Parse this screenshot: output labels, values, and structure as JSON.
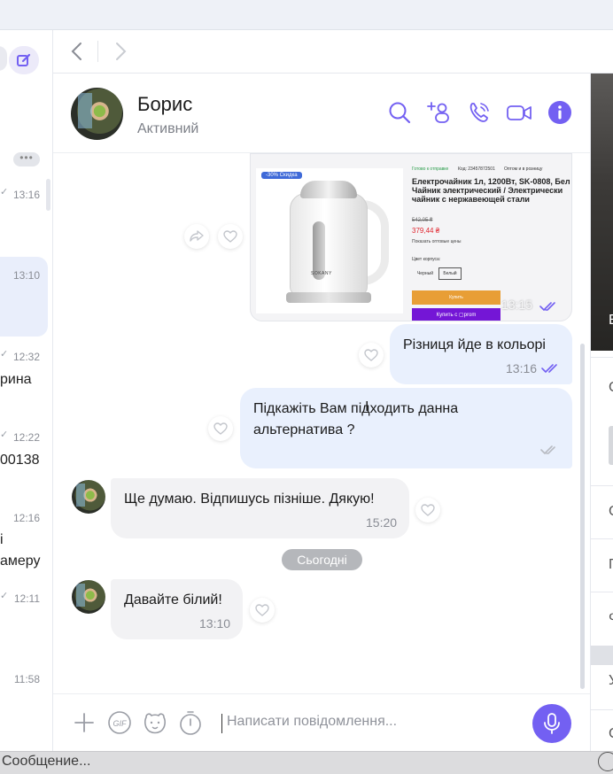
{
  "left_list": {
    "items": [
      {
        "time": "13:16",
        "text": ""
      },
      {
        "time": "13:10",
        "text": ""
      },
      {
        "time": "12:32",
        "text": "рина"
      },
      {
        "time": "12:22",
        "text": "00138"
      },
      {
        "time": "12:16",
        "text": "і",
        "text2": "амеру"
      },
      {
        "time": "12:11",
        "text": ""
      },
      {
        "time": "11:58",
        "text": ""
      }
    ],
    "more_label": "•••"
  },
  "chat_header": {
    "name": "Борис",
    "status": "Активний"
  },
  "product_card": {
    "badge": "-30% Скидка",
    "availability": "Готово к отправке",
    "code": "Код: 23457872501",
    "wholesale": "Оптом и в розницу",
    "title": "Електрочайник 1л, 1200Вт, SK-0808, Бел / Чайник электрический / Электрически чайник с нержавеющей стали",
    "old_price": "542,05 ₴",
    "price": "379,44 ₴",
    "wholesale_link": "Показать оптовые цены",
    "color_label": "Цвет корпуса:",
    "option_black": "Черный",
    "option_white": "Белый",
    "buy_label": "Купить",
    "prom_label": "Купить с ▢prom",
    "brand": "SOKANY"
  },
  "messages": [
    {
      "id": "img",
      "direction": "out",
      "time": "13:15"
    },
    {
      "id": "m1",
      "direction": "out",
      "text": "Різниця йде в кольорі",
      "time": "13:16"
    },
    {
      "id": "m2",
      "direction": "out",
      "text": "Підкажіть Вам підходить данна альтернатива ?",
      "time": ""
    },
    {
      "id": "m3",
      "direction": "in",
      "text": "Ще думаю. Відпишусь пізніше. Дякую!",
      "time": "15:20"
    },
    {
      "id": "m4",
      "direction": "in",
      "text": "Давайте білий!",
      "time": "13:10"
    }
  ],
  "date_separator": "Сьогодні",
  "composer": {
    "placeholder": "Написати повідомлення..."
  },
  "right_panel": {
    "photo_letter": "Е",
    "letters": [
      "С",
      "П",
      "Ф",
      "У",
      "С"
    ]
  },
  "bottom_strip": {
    "text": "Сообщение..."
  },
  "colors": {
    "accent": "#7360f2",
    "outgoing_bubble": "#e9f0fd",
    "incoming_bubble": "#f2f2f4"
  }
}
